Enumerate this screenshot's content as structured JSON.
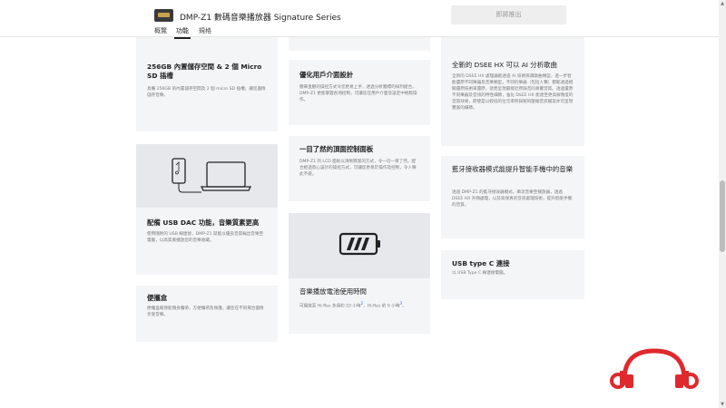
{
  "header": {
    "product_title": "DMP-Z1 數碼音樂播放器 Signature Series",
    "tabs": [
      {
        "label": "概覽"
      },
      {
        "label": "功能"
      },
      {
        "label": "規格"
      }
    ],
    "active_tab": "功能",
    "buy_label": "即將推出"
  },
  "features": {
    "storage": {
      "title": "256GB 內置儲存空間 & 2 個 Micro SD 插槽",
      "body": "具備 256GB 的內置儲存空間及 2 個 micro SD 插槽，讓您盡情儲存音樂。"
    },
    "ui": {
      "title": "優化用戶介面設計",
      "body": "簡單直觀的操控方式令您更易上手，透過分析圖標的排列組合，DMP-Z1 更能掌握各項控制，可讓您在用戶介面及設定中輕鬆操作。"
    },
    "dsee": {
      "title": "全新的 DSEE HX 可以 AI 分析歌曲",
      "body": "全新的 DSEE HX 處理器能透過 AI 技術辨識歌曲類型，進一步智能還原不同樂器及音樂類型，不同的樂器（包括人聲）都能透過相關還原技術來還原，從而呈現最接近原錄音的真實音質。透過還原不同樂器及音訊的特性細節，強化 DSEE HX 能達至更高解像度的音質效果，即使是以較低的位元率所錄製的壓縮音訊檔案亦可呈現豐富的細節。"
    },
    "panel": {
      "title": "一目了然的頂面控制面板",
      "body": "DMP-Z1 的 LCD 面板以清晰簡潔的方式，令一切一目了然。配合經過悉心設計的操控方式，可讓您更易於操作及控制，令人樂此不疲。"
    },
    "bt": {
      "title": "藍牙接收器模式能提升智能手機中的音樂",
      "body": "透過 DMP-Z1 的藍牙接收器模式，串流音樂至播放器，透過 DSEE HX 升頻處理，以及高保真的音訊處理技術，提升智能手機的音質。"
    },
    "usb_dac": {
      "title": "配備 USB DAC 功能，音樂質素更高",
      "body": "使用隨附的 USB 線連接，DMP-Z1 就能以優良音質輸出音樂至電腦，以高質素播放您的音樂收藏。"
    },
    "battery": {
      "title": "音樂播放電池使用時間",
      "body_prefix": "可播放至 Hi-Res 多達約 10 小時",
      "sup1": "2",
      "body_mid": "，Hi-Res 約 9 小時",
      "sup2": "3",
      "body_suffix": "。"
    },
    "usbc": {
      "title": "USB type C 連接",
      "body": "以 USB Type C 線連接電腦。"
    },
    "portable": {
      "title": "便攜盒",
      "body": "便攜盒確保能隨身攜帶，方便攜帶及保護，讓您在不同場合盡情享受音樂。"
    }
  },
  "colors": {
    "card_bg": "#f4f5f7",
    "image_bg": "#e6e8ec",
    "logo_red": "#e0292d",
    "link_blue": "#2b6cd4"
  },
  "icons": {
    "laptop": "laptop-phone-icon",
    "battery": "battery-icon",
    "logo": "headphones-logo-icon"
  }
}
